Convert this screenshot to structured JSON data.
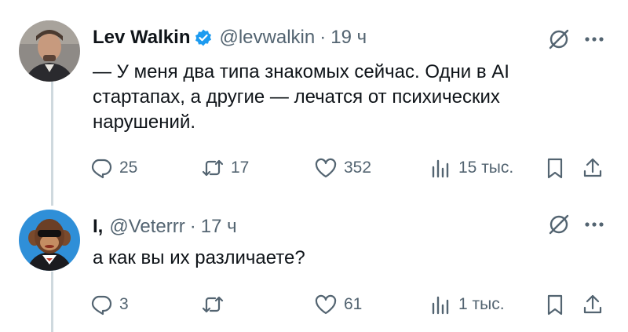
{
  "tweets": [
    {
      "author_name": "Lev Walkin",
      "verified": true,
      "handle": "@levwalkin",
      "separator": "·",
      "time": "19 ч",
      "text": "— У меня два типа знакомых сейчас. Одни в AI\nстартапах, а другие — лечатся от психических\nнарушений.",
      "replies": "25",
      "reposts": "17",
      "likes": "352",
      "views": "15 тыс.",
      "icons": [
        "grok-icon",
        "more-icon",
        "reply-icon",
        "repost-icon",
        "like-icon",
        "views-icon",
        "bookmark-icon",
        "share-icon"
      ]
    },
    {
      "author_name": "I,",
      "verified": false,
      "handle": "@Veterrr",
      "separator": "·",
      "time": "17 ч",
      "text": "а как вы их различаете?",
      "replies": "3",
      "reposts": "",
      "likes": "61",
      "views": "1 тыс.",
      "icons": [
        "grok-icon",
        "more-icon",
        "reply-icon",
        "repost-icon",
        "like-icon",
        "views-icon",
        "bookmark-icon",
        "share-icon"
      ]
    }
  ],
  "colors": {
    "text": "#0f1419",
    "secondary": "#536471",
    "verified_blue": "#1d9bf0",
    "thread_line": "#cfd9de"
  }
}
